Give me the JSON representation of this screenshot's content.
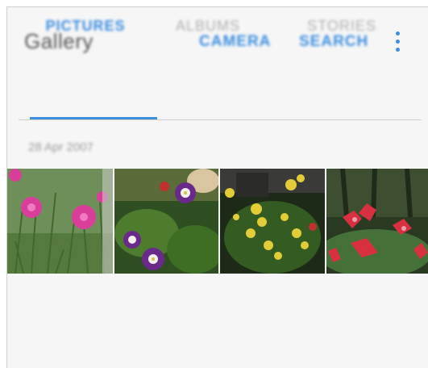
{
  "header": {
    "title": "Gallery",
    "actions": [
      {
        "label": "CAMERA"
      },
      {
        "label": "SEARCH"
      }
    ],
    "more_icon": "more-vert-icon",
    "accent_color": "#3d8ee0"
  },
  "tabs": [
    {
      "label": "PICTURES",
      "selected": true
    },
    {
      "label": "ALBUMS",
      "selected": false
    },
    {
      "label": "STORIES",
      "selected": false
    }
  ],
  "content": {
    "date": "28 Apr 2007",
    "photos": [
      {
        "subject": "pink flowers"
      },
      {
        "subject": "purple columbine flowers"
      },
      {
        "subject": "yellow flowers"
      },
      {
        "subject": "red flowers"
      }
    ]
  }
}
